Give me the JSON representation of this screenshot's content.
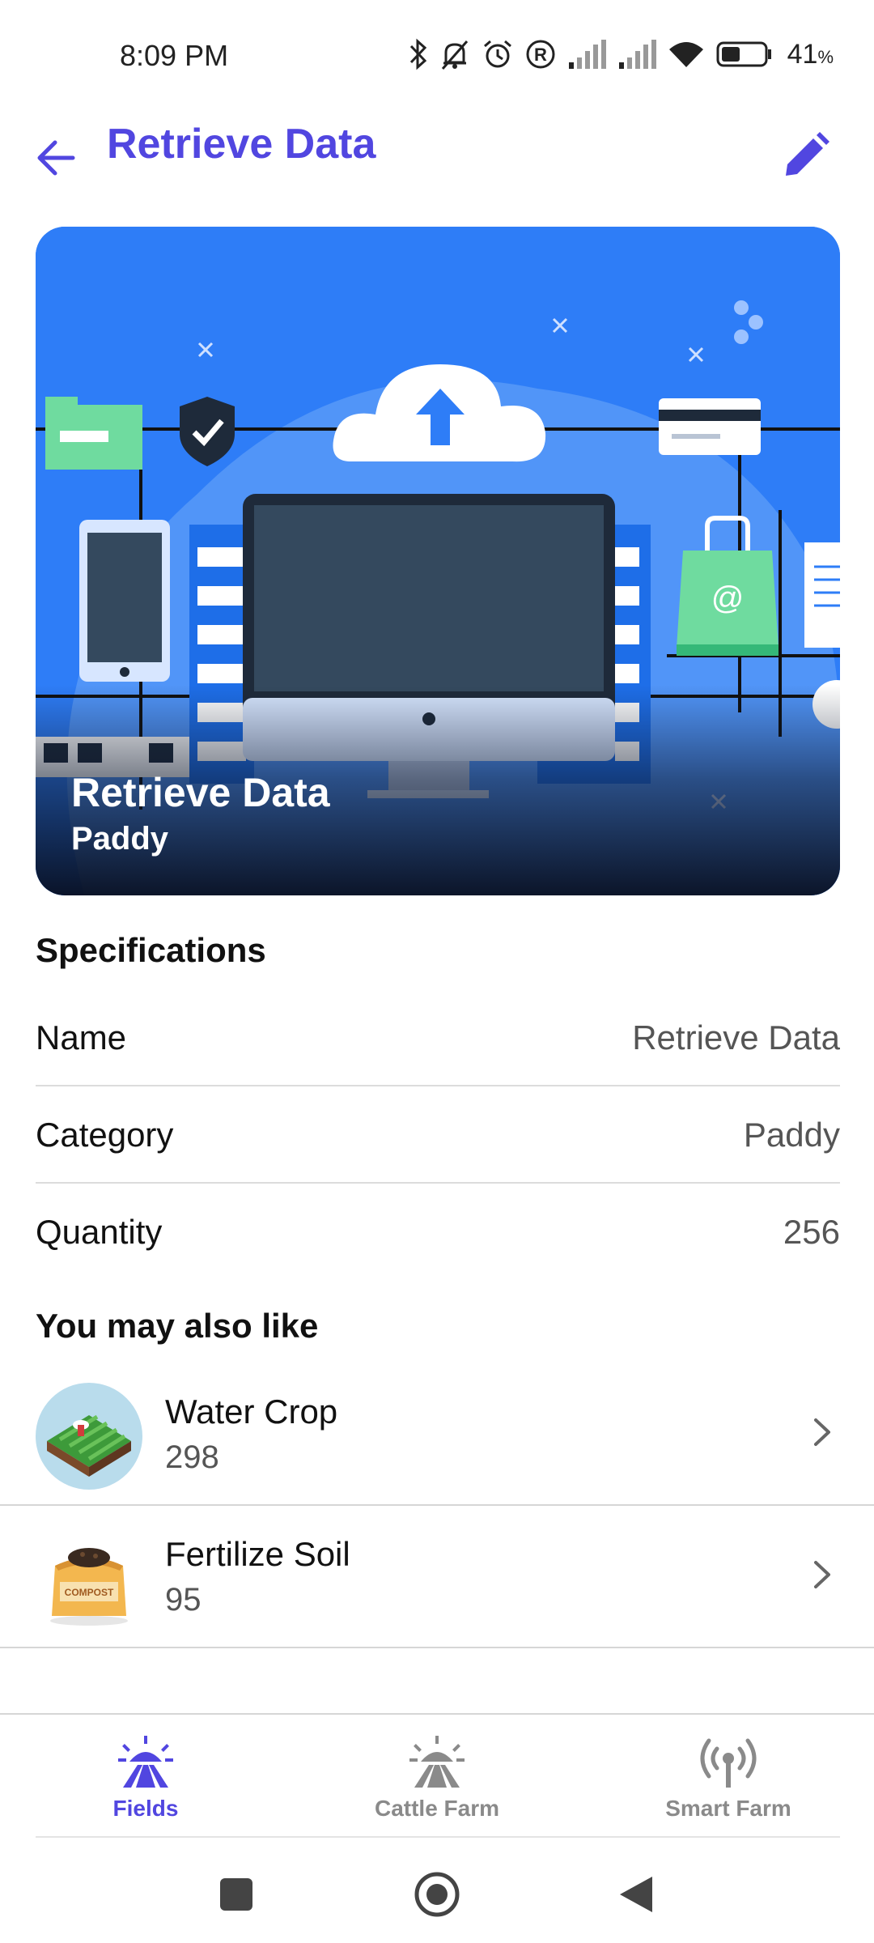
{
  "status_bar": {
    "time": "8:09 PM",
    "battery_percent": "41",
    "battery_unit": "%"
  },
  "app_bar": {
    "title": "Retrieve Data"
  },
  "hero": {
    "title": "Retrieve Data",
    "subtitle": "Paddy"
  },
  "specifications": {
    "heading": "Specifications",
    "rows": [
      {
        "label": "Name",
        "value": "Retrieve Data"
      },
      {
        "label": "Category",
        "value": "Paddy"
      },
      {
        "label": "Quantity",
        "value": "256"
      }
    ]
  },
  "suggestions": {
    "heading": "You may also like",
    "items": [
      {
        "name": "Water Crop",
        "quantity": "298"
      },
      {
        "name": "Fertilize Soil",
        "quantity": "95",
        "thumb_text": "COMPOST"
      }
    ]
  },
  "bottom_nav": {
    "items": [
      {
        "label": "Fields",
        "icon": "field-sun-icon",
        "active": true
      },
      {
        "label": "Cattle Farm",
        "icon": "field-sun-icon",
        "active": false
      },
      {
        "label": "Smart Farm",
        "icon": "antenna-icon",
        "active": false
      }
    ]
  },
  "colors": {
    "accent": "#5146e0",
    "hero_bg": "#2e7df7",
    "muted_text": "#555555"
  }
}
